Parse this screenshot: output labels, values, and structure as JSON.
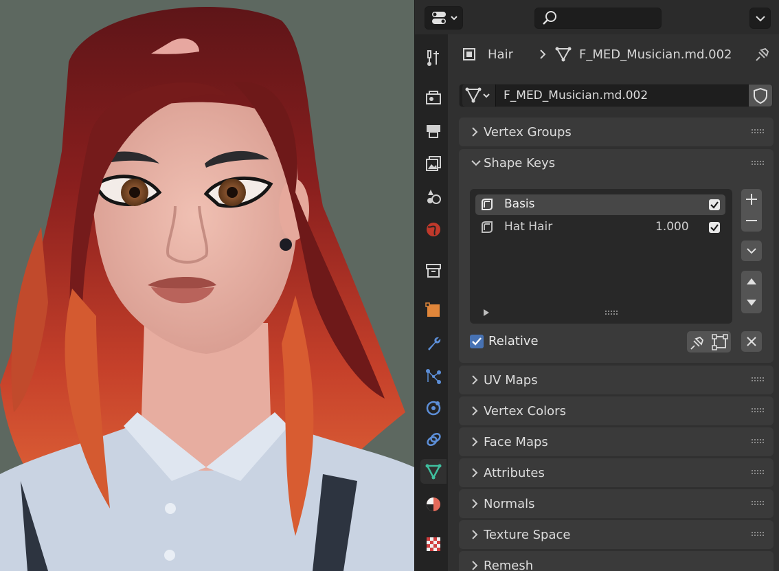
{
  "properties": {
    "breadcrumb": {
      "object_name": "Hair",
      "mesh_name": "F_MED_Musician.md.002"
    },
    "mesh_datablock": {
      "name": "F_MED_Musician.md.002"
    },
    "panels": {
      "vertex_groups": "Vertex Groups",
      "shape_keys": "Shape Keys",
      "uv_maps": "UV Maps",
      "vertex_colors": "Vertex Colors",
      "face_maps": "Face Maps",
      "attributes": "Attributes",
      "normals": "Normals",
      "texture_space": "Texture Space",
      "remesh": "Remesh"
    },
    "shape_keys": {
      "items": [
        {
          "name": "Basis",
          "value": "",
          "checked": true,
          "selected": true
        },
        {
          "name": "Hat Hair",
          "value": "1.000",
          "checked": true,
          "selected": false
        }
      ],
      "relative_label": "Relative",
      "relative_checked": true
    },
    "colors": {
      "accent": "#4772b3",
      "active_tab_icon": "#3fbf9f",
      "panel_bg": "#3a3a3a"
    }
  }
}
